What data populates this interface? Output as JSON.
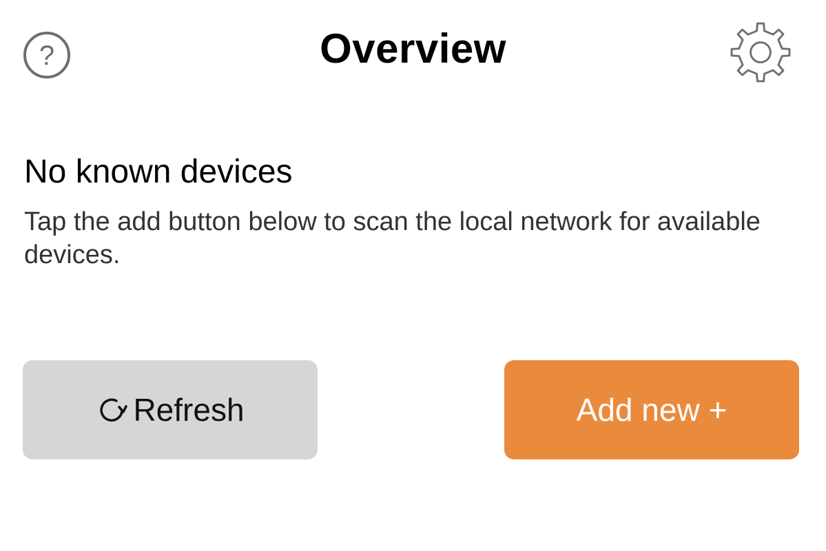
{
  "header": {
    "title": "Overview",
    "help_icon": "question-circle-icon",
    "settings_icon": "gear-icon"
  },
  "empty_state": {
    "title": "No known devices",
    "description": "Tap the add button below to scan the local network for available devices."
  },
  "actions": {
    "refresh_label": "Refresh",
    "refresh_icon": "refresh-icon",
    "add_label": "Add new +"
  },
  "colors": {
    "accent": "#EA8A3C",
    "secondary_button": "#D6D6D6",
    "icon_gray": "#6E6E6E"
  }
}
